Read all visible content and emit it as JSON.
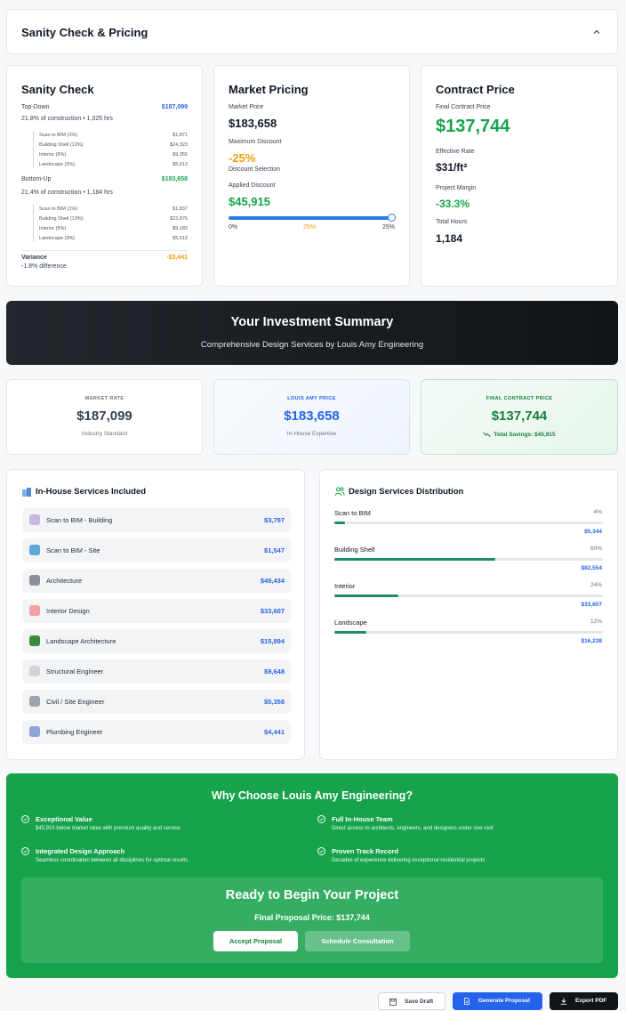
{
  "header": {
    "title": "Sanity Check & Pricing"
  },
  "sanity": {
    "title": "Sanity Check",
    "top_down": {
      "label": "Top-Down",
      "value": "$187,099",
      "desc": "21.8% of construction • 1,025 hrs",
      "items": [
        {
          "name": "Scan to BIM (1%)",
          "value": "$1,871"
        },
        {
          "name": "Building Shell (13%)",
          "value": "$24,323"
        },
        {
          "name": "Interior (5%)",
          "value": "$9,355"
        },
        {
          "name": "Landscape (3%)",
          "value": "$5,613"
        }
      ]
    },
    "bottom_up": {
      "label": "Bottom-Up",
      "value": "$183,658",
      "desc": "21.4% of construction • 1,184 hrs",
      "items": [
        {
          "name": "Scan to BIM (1%)",
          "value": "$1,837"
        },
        {
          "name": "Building Shell (13%)",
          "value": "$23,876"
        },
        {
          "name": "Interior (5%)",
          "value": "$9,183"
        },
        {
          "name": "Landscape (3%)",
          "value": "$5,510"
        }
      ]
    },
    "variance": {
      "label": "Variance",
      "value": "-$3,441",
      "desc": "-1.8% difference"
    }
  },
  "market": {
    "title": "Market Pricing",
    "price_label": "Market Price",
    "price": "$183,658",
    "max_discount_label": "Maximum Discount",
    "max_discount": "-25%",
    "discount_selection_label": "Discount Selection",
    "applied_label": "Applied Discount",
    "applied": "$45,915",
    "slider": {
      "value_pct": 25,
      "min": "0%",
      "mid": "25%",
      "max": "25%"
    }
  },
  "contract": {
    "title": "Contract Price",
    "final_label": "Final Contract Price",
    "final": "$137,744",
    "rate_label": "Effective Rate",
    "rate": "$31/ft²",
    "margin_label": "Project Margin",
    "margin": "-33.3%",
    "hours_label": "Total Hours",
    "hours": "1,184"
  },
  "banner": {
    "title": "Your Investment Summary",
    "subtitle": "Comprehensive Design Services by Louis Amy Engineering"
  },
  "rates": {
    "market": {
      "label": "MARKET RATE",
      "value": "$187,099",
      "sub": "Industry Standard"
    },
    "louis": {
      "label": "LOUIS AMY PRICE",
      "value": "$183,658",
      "sub": "In-House Expertise"
    },
    "final": {
      "label": "FINAL CONTRACT PRICE",
      "value": "$137,744",
      "sub": "Total Savings: $45,915"
    }
  },
  "services": {
    "title": "In-House Services Included",
    "items": [
      {
        "name": "Scan to BIM - Building",
        "price": "$3,797",
        "icon": "robot-arm-icon",
        "color": "#c7b8e0"
      },
      {
        "name": "Scan to BIM - Site",
        "price": "$1,547",
        "icon": "map-icon",
        "color": "#5fa8d3"
      },
      {
        "name": "Architecture",
        "price": "$49,434",
        "icon": "classical-building-icon",
        "color": "#8b8f96"
      },
      {
        "name": "Interior Design",
        "price": "$33,607",
        "icon": "palette-icon",
        "color": "#f2a2a2"
      },
      {
        "name": "Landscape Architecture",
        "price": "$15,894",
        "icon": "tree-icon",
        "color": "#3c8a3e"
      },
      {
        "name": "Structural Engineer",
        "price": "$9,648",
        "icon": "bone-icon",
        "color": "#d1d5db"
      },
      {
        "name": "Civil / Site Engineer",
        "price": "$5,358",
        "icon": "triangle-ruler-icon",
        "color": "#9ca3af"
      },
      {
        "name": "Plumbing Engineer",
        "price": "$4,441",
        "icon": "pipe-icon",
        "color": "#8ea3d8"
      }
    ]
  },
  "distribution": {
    "title": "Design Services Distribution",
    "items": [
      {
        "name": "Scan to BIM",
        "pct_label": "4%",
        "fraction": 0.04,
        "amount": "$5,344"
      },
      {
        "name": "Building Shell",
        "pct_label": "60%",
        "fraction": 0.6,
        "amount": "$82,554"
      },
      {
        "name": "Interior",
        "pct_label": "24%",
        "fraction": 0.24,
        "amount": "$33,607"
      },
      {
        "name": "Landscape",
        "pct_label": "12%",
        "fraction": 0.12,
        "amount": "$16,238"
      }
    ]
  },
  "why": {
    "title": "Why Choose Louis Amy Engineering?",
    "features": [
      {
        "title": "Exceptional Value",
        "desc": "$45,915 below market rates with premium quality and service"
      },
      {
        "title": "Full In-House Team",
        "desc": "Direct access to architects, engineers, and designers under one roof"
      },
      {
        "title": "Integrated Design Approach",
        "desc": "Seamless coordination between all disciplines for optimal results"
      },
      {
        "title": "Proven Track Record",
        "desc": "Decades of experience delivering exceptional residential projects"
      }
    ],
    "cta": {
      "title": "Ready to Begin Your Project",
      "price_line": "Final Proposal Price: $137,744",
      "accept": "Accept Proposal",
      "schedule": "Schedule Consultation"
    }
  },
  "footer": {
    "save": "Save Draft",
    "generate": "Generate Proposal",
    "export": "Export PDF"
  },
  "colors": {
    "accent_blue": "#2563eb",
    "green": "#16a34a",
    "orange": "#f59e0b",
    "dark": "#16191d"
  }
}
